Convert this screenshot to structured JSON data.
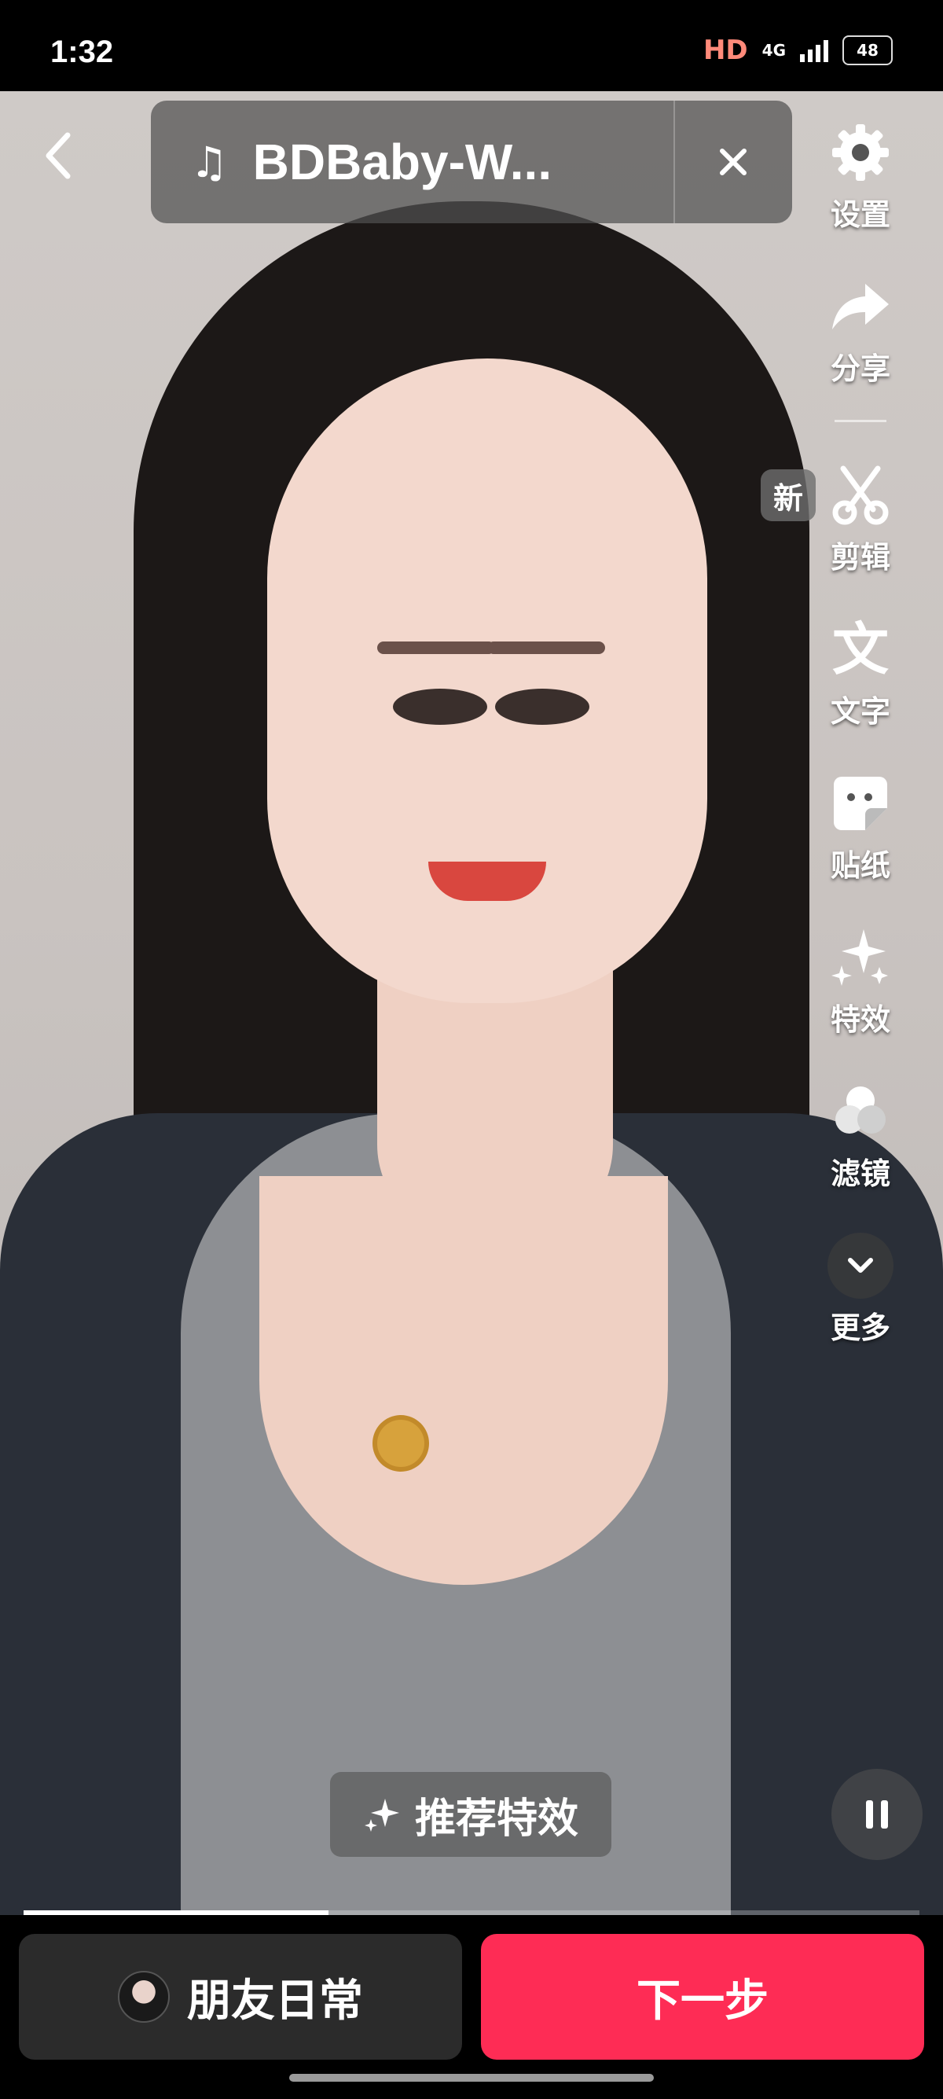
{
  "status_bar": {
    "time": "1:32",
    "hd": "HD",
    "network": "4G",
    "battery": "48"
  },
  "music": {
    "title": "BDBaby-W..."
  },
  "toolbar": {
    "settings": "设置",
    "share": "分享",
    "new_badge": "新",
    "edit": "剪辑",
    "text": "文字",
    "sticker": "贴纸",
    "effects": "特效",
    "filter": "滤镜",
    "more": "更多"
  },
  "recommend_effect": "推荐特效",
  "playback": {
    "progress": 0.34
  },
  "bottom": {
    "friends_label": "朋友日常",
    "next_label": "下一步"
  },
  "colors": {
    "accent": "#fe2c55",
    "panel": "#2b2b2b"
  }
}
